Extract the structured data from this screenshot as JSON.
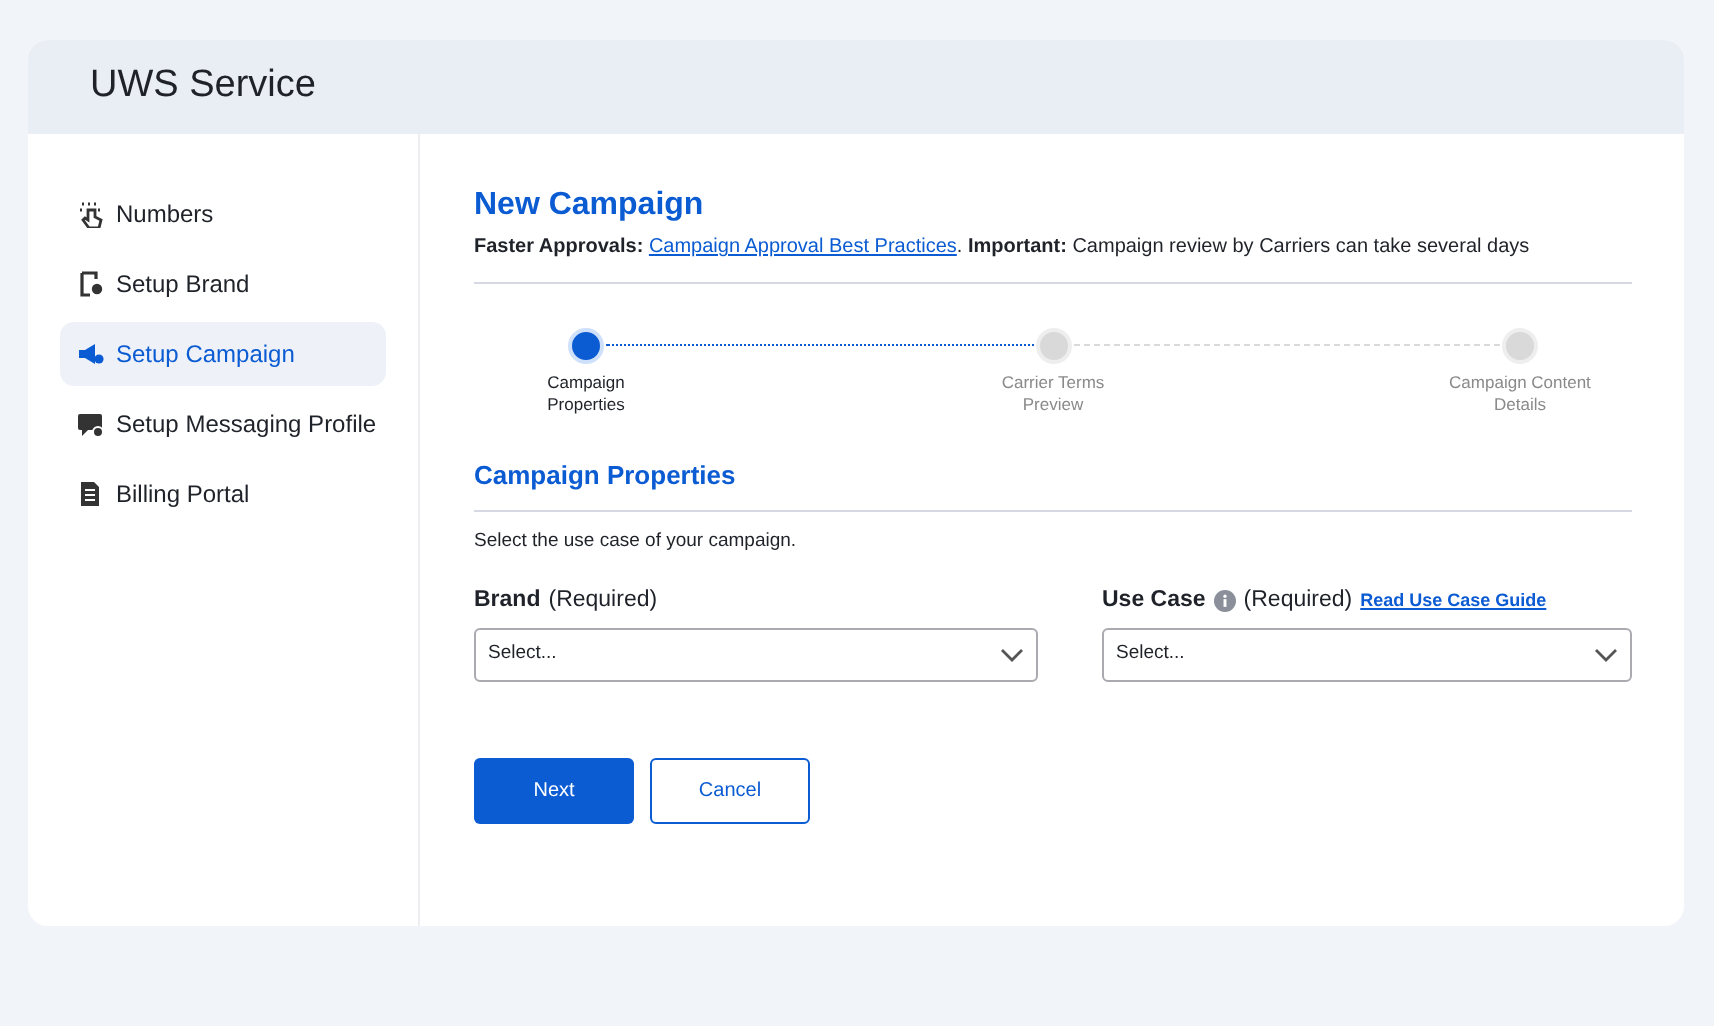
{
  "app_title": "UWS Service",
  "sidebar": {
    "items": [
      {
        "label": "Numbers",
        "selected": false
      },
      {
        "label": "Setup Brand",
        "selected": false
      },
      {
        "label": "Setup Campaign",
        "selected": true
      },
      {
        "label": "Setup Messaging Profile",
        "selected": false
      },
      {
        "label": "Billing Portal",
        "selected": false
      }
    ]
  },
  "page": {
    "title": "New Campaign",
    "notice": {
      "lead": "Faster Approvals:",
      "link": "Campaign Approval Best Practices",
      "rest": ". **Important:** Campaign review by Carriers can take several days"
    }
  },
  "steps": [
    {
      "label": "Campaign Properties",
      "selected": true
    },
    {
      "label": "Carrier Terms Preview",
      "selected": false
    },
    {
      "label": "Campaign Content Details",
      "selected": false
    }
  ],
  "section": {
    "title": "Campaign Properties",
    "description": "Select the use case of your campaign."
  },
  "fields": [
    {
      "label": "Brand",
      "info": false,
      "note": "(Required)",
      "placeholder": "Select..."
    },
    {
      "label": "Use Case",
      "info": true,
      "note": "(Required)",
      "link": "Read Use Case Guide",
      "placeholder": "Select..."
    }
  ],
  "buttons": [
    {
      "label": "Next",
      "kind": "primary"
    },
    {
      "label": "Cancel",
      "kind": "secondary"
    }
  ]
}
